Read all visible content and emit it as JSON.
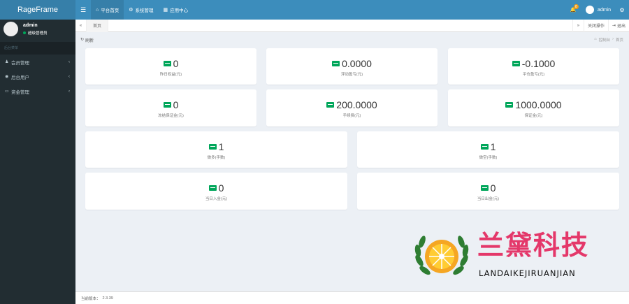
{
  "app": {
    "brand": "RageFrame"
  },
  "topnav": {
    "items": [
      {
        "label": "平台首页",
        "icon": "home-icon"
      },
      {
        "label": "系统管理",
        "icon": "cogs-icon"
      },
      {
        "label": "应用中心",
        "icon": "apps-icon"
      }
    ],
    "notification_count": "8",
    "username": "admin"
  },
  "sidebar": {
    "user": {
      "name": "admin",
      "role": "超级管理员"
    },
    "section_header": "后台菜单",
    "items": [
      {
        "label": "会员管理",
        "icon": "user-icon"
      },
      {
        "label": "后台用户",
        "icon": "user-circle-icon"
      },
      {
        "label": "资金管理",
        "icon": "card-icon"
      }
    ]
  },
  "tabbar": {
    "tabs": [
      {
        "label": "首页"
      }
    ],
    "close_ops": "关闭操作",
    "logout": "退出"
  },
  "content": {
    "refresh": "刷新",
    "breadcrumb": [
      "控制台",
      "首页"
    ]
  },
  "stats": [
    {
      "value": "0",
      "label": "昨日权益(元)"
    },
    {
      "value": "0.0000",
      "label": "浮动盈亏(元)"
    },
    {
      "value": "-0.1000",
      "label": "平仓盈亏(元)"
    },
    {
      "value": "0",
      "label": "冻结保证金(元)"
    },
    {
      "value": "200.0000",
      "label": "手续费(元)"
    },
    {
      "value": "1000.0000",
      "label": "保证金(元)"
    },
    {
      "value": "1",
      "label": "做多(手数)"
    },
    {
      "value": "1",
      "label": "做空(手数)"
    },
    {
      "value": "0",
      "label": "当日入金(元)"
    },
    {
      "value": "0",
      "label": "当日出金(元)"
    }
  ],
  "footer": {
    "version_label": "当前版本：",
    "version": "2.3.39"
  },
  "watermark": {
    "cn": "兰黛科技",
    "en": "LANDAIKEJIRUANJIAN"
  },
  "colors": {
    "topbar": "#3c8dbc",
    "sidebar": "#222d32",
    "accent_green": "#00a65a",
    "watermark_pink": "#e4386a"
  }
}
